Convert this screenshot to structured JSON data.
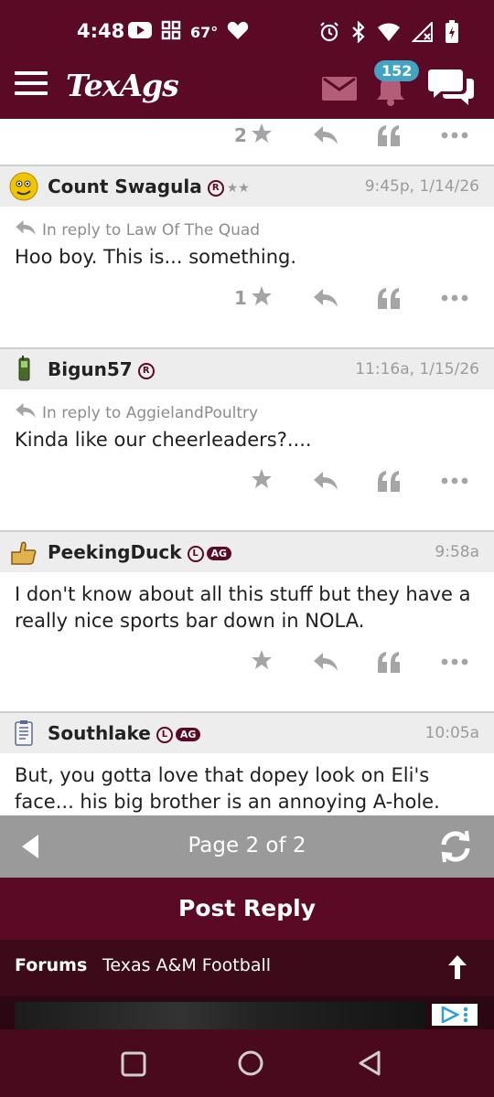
{
  "status_bar": {
    "time": "4:48",
    "temperature": "67°"
  },
  "header": {
    "logo": "TexAgs",
    "notification_count": "152"
  },
  "previous_post_actions": {
    "like_count": "2"
  },
  "posts": [
    {
      "username": "Count Swagula",
      "badge": "R",
      "stars": "★★",
      "time": "9:45p, 1/14/26",
      "reply_to": "In reply to Law Of The Quad",
      "text": "Hoo boy. This is... something.",
      "like_count": "1"
    },
    {
      "username": "Bigun57",
      "badge": "R",
      "time": "11:16a, 1/15/26",
      "reply_to": "In reply to AggielandPoultry",
      "text": "Kinda like our cheerleaders?....",
      "like_count": ""
    },
    {
      "username": "PeekingDuck",
      "badge": "L",
      "ag_badge": "AG",
      "time": "9:58a",
      "text": "I don't know about all this stuff but they have a really nice sports bar down in NOLA.",
      "like_count": ""
    },
    {
      "username": "Southlake",
      "badge": "L",
      "ag_badge": "AG",
      "time": "10:05a",
      "text": "But, you gotta love that dopey look on Eli's face... his big brother is an annoying A-hole.",
      "like_count": ""
    }
  ],
  "pager": {
    "label": "Page 2 of 2"
  },
  "post_reply": {
    "label": "Post Reply"
  },
  "breadcrumb": {
    "root": "Forums",
    "current": "Texas A&M Football"
  },
  "colors": {
    "maroon": "#5b0a25",
    "pager_gray": "#9a9a9a",
    "badge_blue": "#43a3c2"
  }
}
